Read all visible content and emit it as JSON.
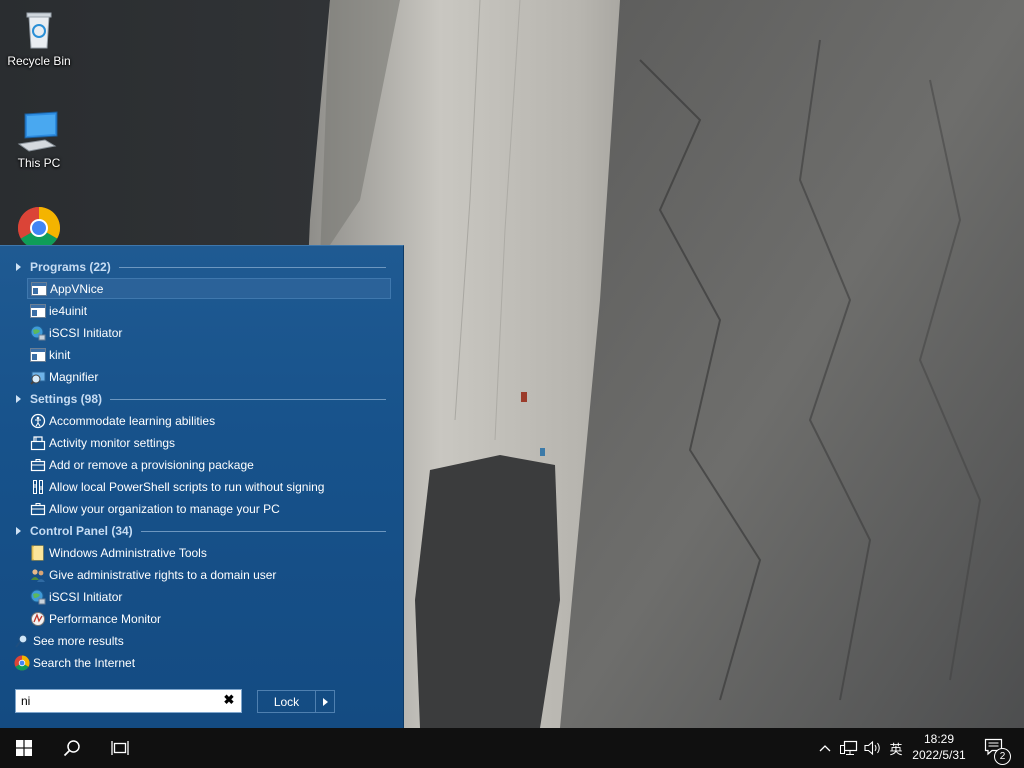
{
  "desktop": {
    "icons": [
      {
        "label": "Recycle Bin",
        "icon": "recycle-bin-icon"
      },
      {
        "label": "This PC",
        "icon": "computer-icon"
      },
      {
        "label": "",
        "icon": "chrome-icon"
      }
    ]
  },
  "start_menu": {
    "groups": [
      {
        "title": "Programs (22)",
        "items": [
          {
            "label": "AppVNice",
            "icon": "app-window-icon",
            "selected": true
          },
          {
            "label": "ie4uinit",
            "icon": "app-window-icon"
          },
          {
            "label": "iSCSI Initiator",
            "icon": "globe-network-icon"
          },
          {
            "label": "kinit",
            "icon": "app-window-icon"
          },
          {
            "label": "Magnifier",
            "icon": "magnifier-icon"
          }
        ]
      },
      {
        "title": "Settings (98)",
        "items": [
          {
            "label": "Accommodate learning abilities",
            "icon": "ease-of-access-icon"
          },
          {
            "label": "Activity monitor settings",
            "icon": "activity-icon"
          },
          {
            "label": "Add or remove a provisioning package",
            "icon": "briefcase-icon"
          },
          {
            "label": "Allow local PowerShell scripts to run without signing",
            "icon": "developer-icon"
          },
          {
            "label": "Allow your organization to manage your PC",
            "icon": "briefcase-icon"
          }
        ]
      },
      {
        "title": "Control Panel (34)",
        "items": [
          {
            "label": "Windows Administrative Tools",
            "icon": "folder-icon"
          },
          {
            "label": "Give administrative rights to a domain user",
            "icon": "users-icon"
          },
          {
            "label": "iSCSI Initiator",
            "icon": "globe-network-icon"
          },
          {
            "label": "Performance Monitor",
            "icon": "performance-icon"
          }
        ]
      }
    ],
    "see_more": "See more results",
    "search_internet": "Search the Internet",
    "search": {
      "value": "ni"
    },
    "lock_label": "Lock"
  },
  "taskbar": {
    "time": "18:29",
    "date": "2022/5/31",
    "ime": "英",
    "notification_count": "2"
  },
  "colors": {
    "start_menu_bg": "#17528b",
    "selected_bg": "#2b6299",
    "taskbar_bg": "#101010"
  }
}
